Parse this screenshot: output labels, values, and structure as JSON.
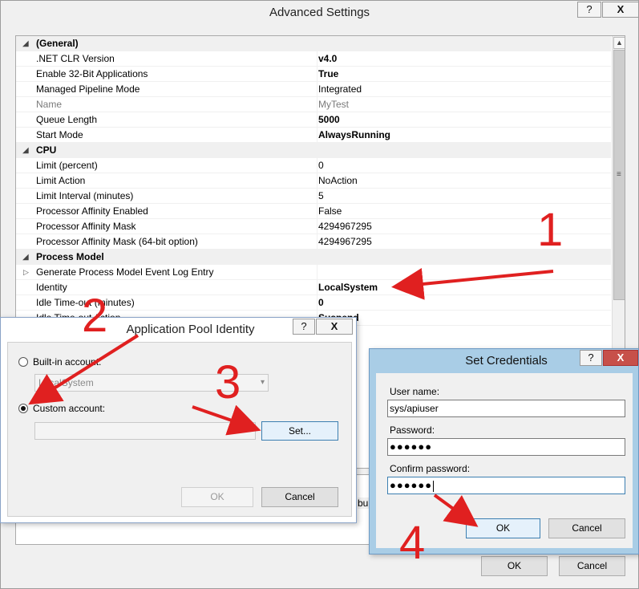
{
  "main": {
    "title": "Advanced Settings",
    "help": "?",
    "close": "X",
    "rows": [
      {
        "kind": "cat",
        "name": "(General)",
        "value": ""
      },
      {
        "kind": "prop",
        "name": ".NET CLR Version",
        "value": "v4.0",
        "bold": true
      },
      {
        "kind": "prop",
        "name": "Enable 32-Bit Applications",
        "value": "True",
        "bold": true
      },
      {
        "kind": "prop",
        "name": "Managed Pipeline Mode",
        "value": "Integrated"
      },
      {
        "kind": "prop",
        "name": "Name",
        "value": "MyTest",
        "grey": true
      },
      {
        "kind": "prop",
        "name": "Queue Length",
        "value": "5000",
        "bold": true
      },
      {
        "kind": "prop",
        "name": "Start Mode",
        "value": "AlwaysRunning",
        "bold": true
      },
      {
        "kind": "cat",
        "name": "CPU",
        "value": ""
      },
      {
        "kind": "prop",
        "name": "Limit (percent)",
        "value": "0"
      },
      {
        "kind": "prop",
        "name": "Limit Action",
        "value": "NoAction"
      },
      {
        "kind": "prop",
        "name": "Limit Interval (minutes)",
        "value": "5"
      },
      {
        "kind": "prop",
        "name": "Processor Affinity Enabled",
        "value": "False"
      },
      {
        "kind": "prop",
        "name": "Processor Affinity Mask",
        "value": "4294967295"
      },
      {
        "kind": "prop",
        "name": "Processor Affinity Mask (64-bit option)",
        "value": "4294967295"
      },
      {
        "kind": "cat",
        "name": "Process Model",
        "value": ""
      },
      {
        "kind": "prop",
        "name": "Generate Process Model Event Log Entry",
        "value": "",
        "expander": true
      },
      {
        "kind": "prop",
        "name": "Identity",
        "value": "LocalSystem",
        "bold": true
      },
      {
        "kind": "prop",
        "name": "Idle Time-out (minutes)",
        "value": "0",
        "bold": true
      },
      {
        "kind": "prop",
        "name": "Idle Time-out Action",
        "value": "Suspend",
        "bold": true
      }
    ],
    "desc_fragment": "built-",
    "ok": "OK",
    "cancel": "Cancel"
  },
  "api_dialog": {
    "title": "Application Pool Identity",
    "help": "?",
    "close": "X",
    "builtin_label": "Built-in account:",
    "builtin_value": "LocalSystem",
    "custom_label": "Custom account:",
    "custom_value": "",
    "set_button": "Set...",
    "ok": "OK",
    "cancel": "Cancel"
  },
  "cred_dialog": {
    "title": "Set Credentials",
    "help": "?",
    "close": "X",
    "username_label": "User name:",
    "username_value": "sys/apiuser",
    "password_label": "Password:",
    "password_value": "●●●●●●",
    "confirm_label": "Confirm password:",
    "confirm_value": "●●●●●●",
    "ok": "OK",
    "cancel": "Cancel"
  },
  "annotations": {
    "step1": "1",
    "step2": "2",
    "step3": "3",
    "step4": "4",
    "color": "#e02020"
  },
  "icons": {
    "scroll_up": "scroll-up-arrow-icon",
    "expand": "expand-triangle-icon",
    "collapse": "collapse-triangle-icon",
    "combo": "chevron-down-icon"
  }
}
